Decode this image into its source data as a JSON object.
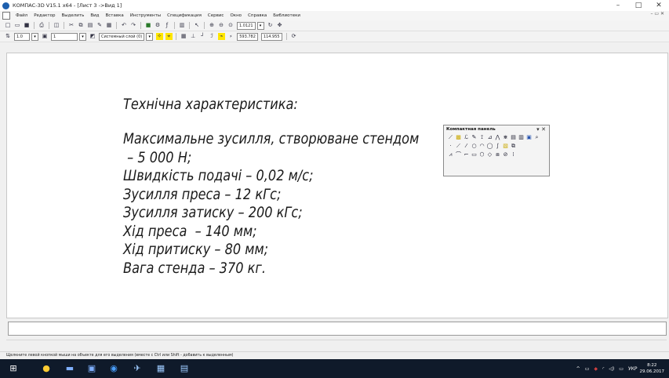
{
  "window": {
    "title": "КОМПАС-3D V15.1 x64 - [Лист 3 ->Вид 1]",
    "controls": [
      "–",
      "□",
      "✕"
    ]
  },
  "menu": {
    "items": [
      "Файл",
      "Редактор",
      "Выделить",
      "Вид",
      "Вставка",
      "Инструменты",
      "Спецификация",
      "Сервис",
      "Окно",
      "Справка",
      "Библиотеки"
    ],
    "mdi_controls": "–  ▭  ✕"
  },
  "toolbar": {
    "zoom_value": "1.0121",
    "step_value": "1.0",
    "layer_number": "1",
    "layer_name": "Системный слой (0)",
    "coord_x": "593.782",
    "coord_y": "114.955"
  },
  "drawing": {
    "heading": "Технічна характеристика:",
    "lines": [
      "Максимальне зусилля, створюване стендом",
      " – 5 000 Н;",
      "Швидкість подачі – 0,02 м/с;",
      "Зусилля преса – 12 кГс;",
      "Зусилля затиску – 200 кГс;",
      "Хід преса  – 140 мм;",
      "Хід притиску – 80 мм;",
      "Вага стенда – 370 кг."
    ]
  },
  "compact_panel": {
    "title": "Компактная панель",
    "controls": "▾ ✕"
  },
  "status": {
    "hint": "Щелкните левой кнопкой мыши на объекте для его выделения (вместе с Ctrl или Shift - добавить к выделенным)"
  },
  "taskbar": {
    "language": "УКР",
    "time": "8:22",
    "date": "29.06.2017"
  }
}
